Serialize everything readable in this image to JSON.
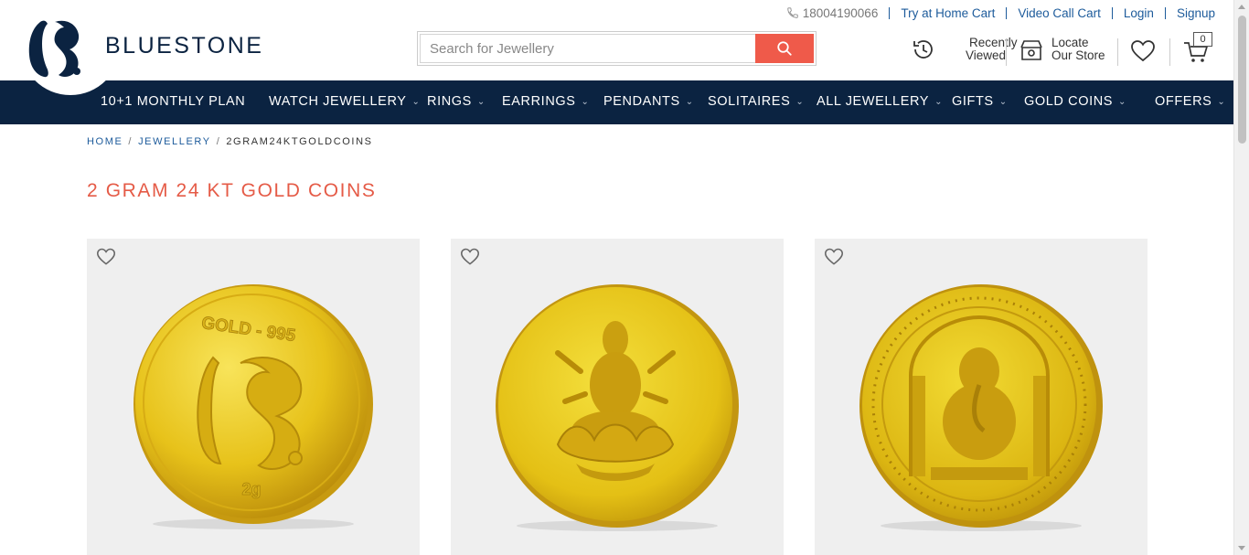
{
  "brand": {
    "name": "BLUESTONE",
    "logo_icon": "bluestone-bs-monogram",
    "navy": "#0b2341",
    "accent": "#ef5a4a"
  },
  "toplinks": {
    "phone": "18004190066",
    "links": [
      "Try at Home Cart",
      "Video Call Cart",
      "Login",
      "Signup"
    ]
  },
  "search": {
    "placeholder": "Search for Jewellery",
    "value": ""
  },
  "header_actions": {
    "recently_viewed": [
      "Recently",
      "Viewed"
    ],
    "locate_store": [
      "Locate",
      "Our Store"
    ],
    "cart_count": "0"
  },
  "nav": {
    "items": [
      {
        "label": "10+1 MONTHLY PLAN",
        "dropdown": false
      },
      {
        "label": "WATCH JEWELLERY",
        "dropdown": true
      },
      {
        "label": "RINGS",
        "dropdown": true
      },
      {
        "label": "EARRINGS",
        "dropdown": true
      },
      {
        "label": "PENDANTS",
        "dropdown": true
      },
      {
        "label": "SOLITAIRES",
        "dropdown": true
      },
      {
        "label": "ALL JEWELLERY",
        "dropdown": true
      },
      {
        "label": "GIFTS",
        "dropdown": true
      },
      {
        "label": "GOLD COINS",
        "dropdown": true
      },
      {
        "label": "OFFERS",
        "dropdown": true
      }
    ]
  },
  "breadcrumb": {
    "home": "HOME",
    "jewellery": "JEWELLERY",
    "current": "2GRAM24KTGOLDCOINS",
    "separator": "/"
  },
  "page": {
    "title": "2 GRAM 24 KT GOLD COINS"
  },
  "products": [
    {
      "image": "gold-coin-bluestone-logo",
      "coin_text_top": "GOLD - 995",
      "coin_text_bottom": "2g"
    },
    {
      "image": "gold-coin-lakshmi"
    },
    {
      "image": "gold-coin-ganesha"
    }
  ]
}
